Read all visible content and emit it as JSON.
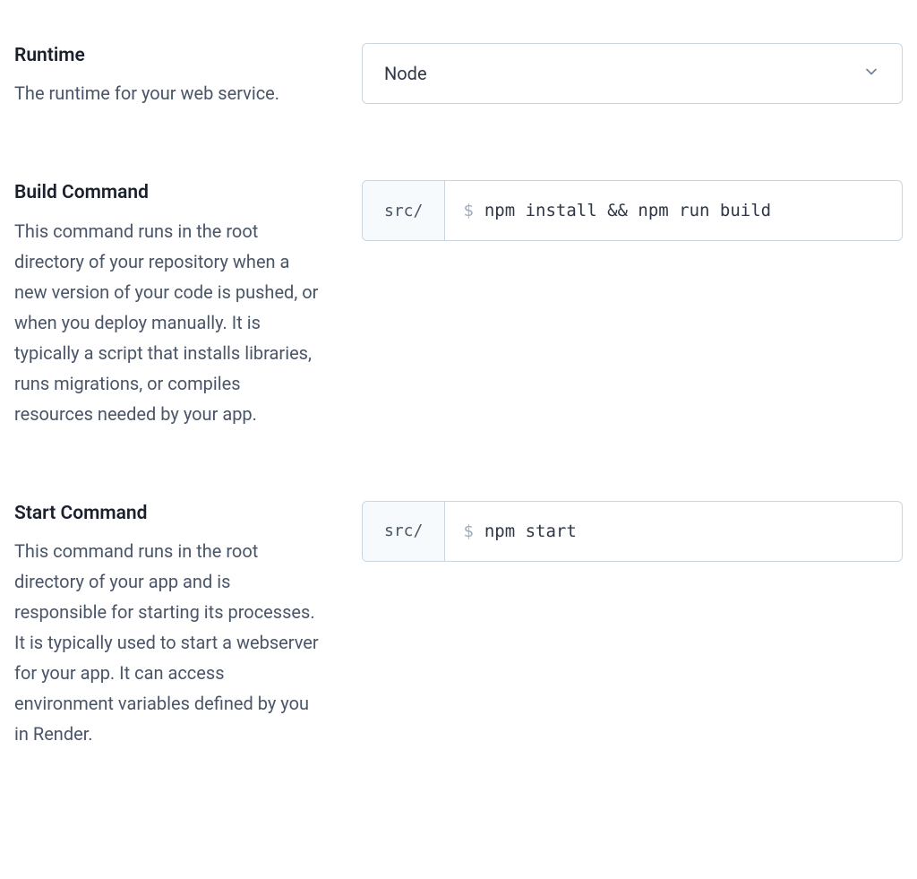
{
  "runtime": {
    "label": "Runtime",
    "description": "The runtime for your web service.",
    "value": "Node"
  },
  "buildCommand": {
    "label": "Build Command",
    "description": "This command runs in the root directory of your repository when a new version of your code is pushed, or when you deploy manually. It is typically a script that installs libraries, runs migrations, or compiles resources needed by your app.",
    "prefix": "src/",
    "dollar": "$",
    "value": "npm install && npm run build"
  },
  "startCommand": {
    "label": "Start Command",
    "description": "This command runs in the root directory of your app and is responsible for starting its processes. It is typically used to start a webserver for your app. It can access environment variables defined by you in Render.",
    "prefix": "src/",
    "dollar": "$",
    "value": "npm start"
  }
}
